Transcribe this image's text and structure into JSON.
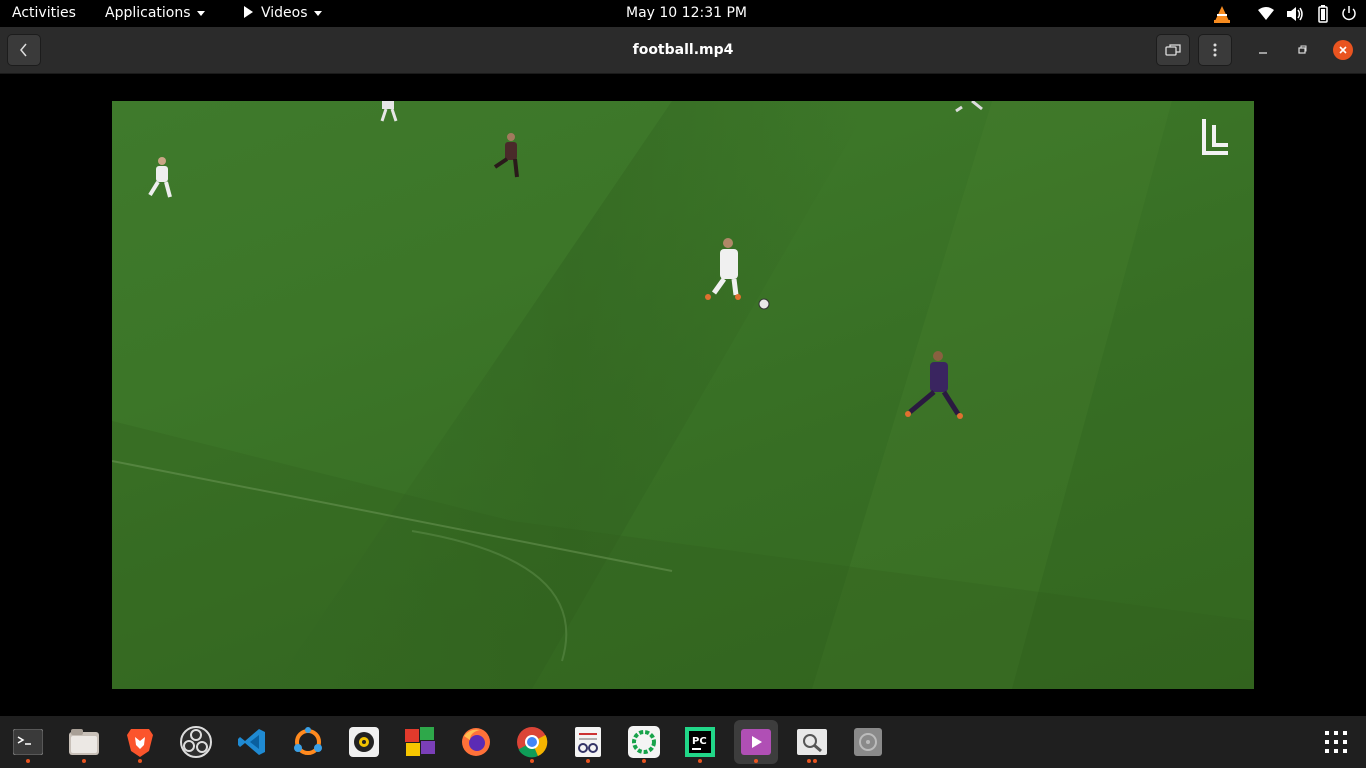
{
  "topbar": {
    "activities": "Activities",
    "applications": "Applications",
    "videos": "Videos",
    "clock": "May 10  12:31 PM",
    "tray_icons": [
      "vlc-icon",
      "wifi-icon",
      "volume-icon",
      "battery-icon",
      "power-menu-icon"
    ]
  },
  "window": {
    "title": "football.mp4",
    "accent_close": "#e95420"
  },
  "dock": {
    "items": [
      "terminal",
      "files",
      "brave",
      "obs",
      "vscode",
      "sublime-merge",
      "rhythmbox",
      "color-grid-app",
      "firefox",
      "chrome",
      "document-viewer",
      "kaspersky",
      "pycharm",
      "videos",
      "image-viewer",
      "cd-drive"
    ],
    "accent_dot": "#e95420"
  }
}
